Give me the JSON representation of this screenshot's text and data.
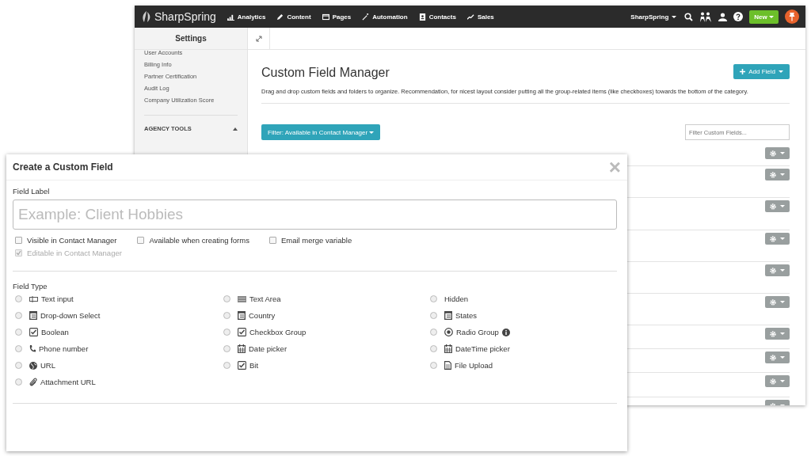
{
  "navbar": {
    "brand": "SharpSpring",
    "items": [
      {
        "label": "Analytics",
        "kind": "bars"
      },
      {
        "label": "Content",
        "kind": "pencil"
      },
      {
        "label": "Pages",
        "kind": "window"
      },
      {
        "label": "Automation",
        "kind": "wand"
      },
      {
        "label": "Contacts",
        "kind": "card"
      },
      {
        "label": "Sales",
        "kind": "trend"
      }
    ],
    "account": "SharpSpring",
    "new_button": "New"
  },
  "sidebar": {
    "title": "Settings",
    "items": [
      "User Accounts",
      "Billing Info",
      "Partner Certification",
      "Audit Log",
      "Company Utilization Score"
    ],
    "section": "AGENCY TOOLS"
  },
  "main": {
    "title": "Custom Field Manager",
    "add_button": "Add Field",
    "description": "Drag and drop custom fields and folders to organize. Recommendation, for nicest layout consider putting all the group-related items (like checkboxes) towards the bottom of the category.",
    "filter_button": "Filter: Available in Contact Manager",
    "search": {
      "placeholder": "Filter Custom Fields..."
    }
  },
  "modal": {
    "title": "Create a Custom Field",
    "close": "×",
    "field_label": "Field Label",
    "input": {
      "placeholder": "Example: Client Hobbies"
    },
    "options": [
      {
        "label": "Visible in Contact Manager",
        "checked": false,
        "disabled": false
      },
      {
        "label": "Available when creating forms",
        "checked": false,
        "disabled": false
      },
      {
        "label": "Email merge variable",
        "checked": false,
        "disabled": false
      },
      {
        "label": "Editable in Contact Manager",
        "checked": true,
        "disabled": true
      }
    ],
    "field_type_label": "Field Type",
    "field_types": [
      {
        "label": "Text input",
        "kind": "textinput",
        "selected": false,
        "info": false
      },
      {
        "label": "Text Area",
        "kind": "textarea",
        "selected": false,
        "info": false
      },
      {
        "label": "Hidden",
        "kind": "none",
        "selected": false,
        "info": false
      },
      {
        "label": "Drop-down Select",
        "kind": "list",
        "selected": false,
        "info": false
      },
      {
        "label": "Country",
        "kind": "list",
        "selected": false,
        "info": false
      },
      {
        "label": "States",
        "kind": "list",
        "selected": false,
        "info": false
      },
      {
        "label": "Boolean",
        "kind": "check",
        "selected": false,
        "info": false
      },
      {
        "label": "Checkbox Group",
        "kind": "check",
        "selected": false,
        "info": false
      },
      {
        "label": "Radio Group",
        "kind": "radio",
        "selected": false,
        "info": true
      },
      {
        "label": "Phone number",
        "kind": "phone",
        "selected": false,
        "info": false
      },
      {
        "label": "Date picker",
        "kind": "calendar",
        "selected": false,
        "info": false
      },
      {
        "label": "DateTime picker",
        "kind": "calendar",
        "selected": false,
        "info": false
      },
      {
        "label": "URL",
        "kind": "globe",
        "selected": false,
        "info": false
      },
      {
        "label": "Bit",
        "kind": "check",
        "selected": false,
        "info": false
      },
      {
        "label": "File Upload",
        "kind": "file",
        "selected": false,
        "info": false
      },
      {
        "label": "Attachment URL",
        "kind": "clip",
        "selected": false,
        "info": false
      }
    ]
  }
}
